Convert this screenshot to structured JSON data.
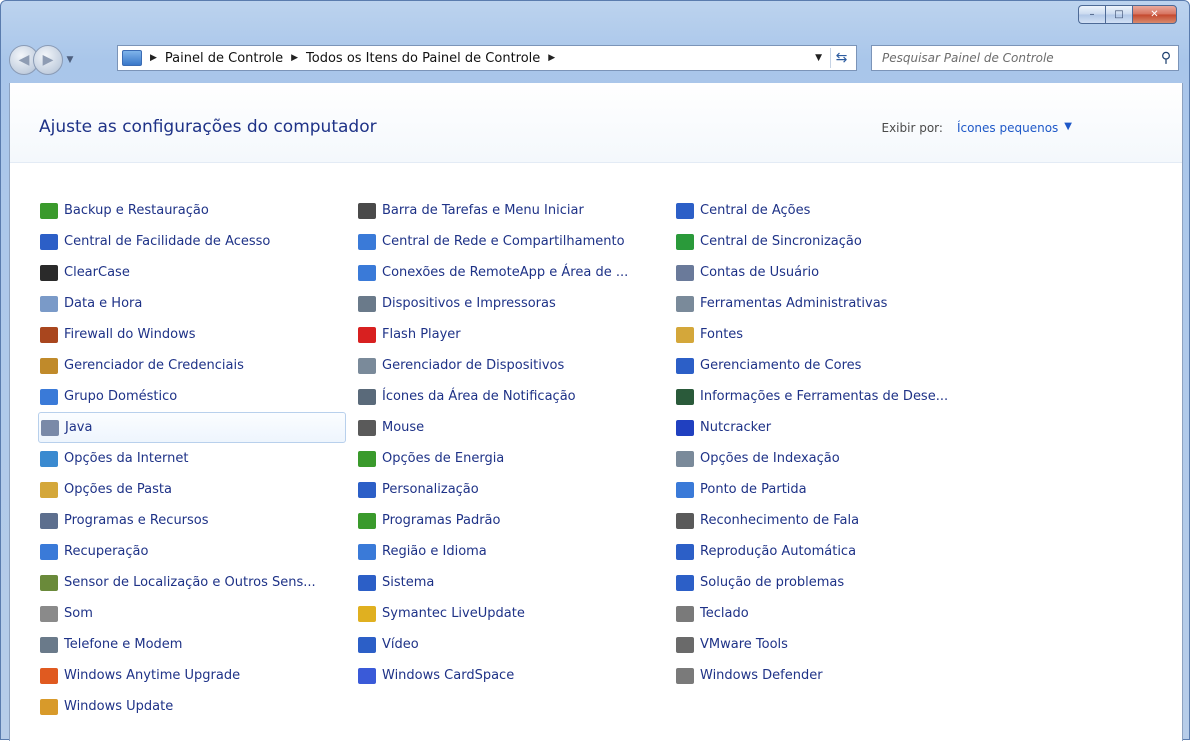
{
  "window": {
    "buttons": {
      "minimize": "–",
      "maximize": "□",
      "close": "✕"
    }
  },
  "nav": {
    "back_icon": "back-arrow-icon",
    "forward_icon": "forward-arrow-icon",
    "breadcrumbs": [
      "Painel de Controle",
      "Todos os Itens do Painel de Controle"
    ],
    "search_placeholder": "Pesquisar Painel de Controle"
  },
  "header": {
    "title": "Ajuste as configurações do computador",
    "view_by_label": "Exibir por:",
    "view_by_value": "Ícones pequenos"
  },
  "columns": [
    [
      {
        "label": "Backup e Restauração",
        "icon": "backup-icon",
        "color": "#3a9a2c"
      },
      {
        "label": "Central de Facilidade de Acesso",
        "icon": "ease-of-access-icon",
        "color": "#2c5fc7"
      },
      {
        "label": "ClearCase",
        "icon": "clearcase-icon",
        "color": "#2a2a2a"
      },
      {
        "label": "Data e Hora",
        "icon": "clock-icon",
        "color": "#7a9ac8"
      },
      {
        "label": "Firewall do Windows",
        "icon": "firewall-icon",
        "color": "#a9461e"
      },
      {
        "label": "Gerenciador de Credenciais",
        "icon": "credentials-icon",
        "color": "#c08a2a"
      },
      {
        "label": "Grupo Doméstico",
        "icon": "homegroup-icon",
        "color": "#3a7ad8"
      },
      {
        "label": "Java",
        "icon": "java-icon",
        "color": "#7a8aa8"
      },
      {
        "label": "Opções da Internet",
        "icon": "internet-options-icon",
        "color": "#3a8ad0"
      },
      {
        "label": "Opções de Pasta",
        "icon": "folder-options-icon",
        "color": "#d4a73a"
      },
      {
        "label": "Programas e Recursos",
        "icon": "programs-icon",
        "color": "#5d6f8e"
      },
      {
        "label": "Recuperação",
        "icon": "recovery-icon",
        "color": "#3a7ad8"
      },
      {
        "label": "Sensor de Localização e Outros Sens...",
        "icon": "sensor-icon",
        "color": "#6a8a3a"
      },
      {
        "label": "Som",
        "icon": "speaker-icon",
        "color": "#8a8a8a"
      },
      {
        "label": "Telefone e Modem",
        "icon": "phone-modem-icon",
        "color": "#6a7a8a"
      },
      {
        "label": "Windows Anytime Upgrade",
        "icon": "windows-flag-icon",
        "color": "#e05a20"
      },
      {
        "label": "Windows Update",
        "icon": "windows-update-icon",
        "color": "#d89a2a"
      }
    ],
    [
      {
        "label": "Barra de Tarefas e Menu Iniciar",
        "icon": "taskbar-icon",
        "color": "#4a4a4a"
      },
      {
        "label": "Central de Rede e Compartilhamento",
        "icon": "network-icon",
        "color": "#3a7ad8"
      },
      {
        "label": "Conexões de RemoteApp e Área de ...",
        "icon": "remoteapp-icon",
        "color": "#3a7ad8"
      },
      {
        "label": "Dispositivos e Impressoras",
        "icon": "printer-icon",
        "color": "#6a7a8a"
      },
      {
        "label": "Flash Player",
        "icon": "flash-icon",
        "color": "#d82020"
      },
      {
        "label": "Gerenciador de Dispositivos",
        "icon": "device-manager-icon",
        "color": "#7a8a9a"
      },
      {
        "label": "Ícones da Área de Notificação",
        "icon": "notification-icon",
        "color": "#5a6a7a"
      },
      {
        "label": "Mouse",
        "icon": "mouse-icon",
        "color": "#5a5a5a"
      },
      {
        "label": "Opções de Energia",
        "icon": "power-icon",
        "color": "#3a9a2c"
      },
      {
        "label": "Personalização",
        "icon": "personalization-icon",
        "color": "#2c5fc7"
      },
      {
        "label": "Programas Padrão",
        "icon": "default-programs-icon",
        "color": "#3a9a2c"
      },
      {
        "label": "Região e Idioma",
        "icon": "region-icon",
        "color": "#3a7ad8"
      },
      {
        "label": "Sistema",
        "icon": "system-icon",
        "color": "#2c5fc7"
      },
      {
        "label": "Symantec LiveUpdate",
        "icon": "symantec-icon",
        "color": "#e0b020"
      },
      {
        "label": "Vídeo",
        "icon": "display-icon",
        "color": "#2c5fc7"
      },
      {
        "label": "Windows CardSpace",
        "icon": "cardspace-icon",
        "color": "#3a5ad8"
      }
    ],
    [
      {
        "label": "Central de Ações",
        "icon": "action-center-flag-icon",
        "color": "#2c5fc7"
      },
      {
        "label": "Central de Sincronização",
        "icon": "sync-icon",
        "color": "#2a9a3a"
      },
      {
        "label": "Contas de Usuário",
        "icon": "user-accounts-icon",
        "color": "#6a7a9a"
      },
      {
        "label": "Ferramentas Administrativas",
        "icon": "admin-tools-icon",
        "color": "#7a8a9a"
      },
      {
        "label": "Fontes",
        "icon": "fonts-icon",
        "color": "#d4a73a"
      },
      {
        "label": "Gerenciamento de Cores",
        "icon": "color-management-icon",
        "color": "#2c5fc7"
      },
      {
        "label": "Informações e Ferramentas de Dese...",
        "icon": "performance-icon",
        "color": "#2a5a3a"
      },
      {
        "label": "Nutcracker",
        "icon": "nutcracker-icon",
        "color": "#2040c0"
      },
      {
        "label": "Opções de Indexação",
        "icon": "indexing-icon",
        "color": "#7a8a9a"
      },
      {
        "label": "Ponto de Partida",
        "icon": "getting-started-icon",
        "color": "#3a7ad8"
      },
      {
        "label": "Reconhecimento de Fala",
        "icon": "microphone-icon",
        "color": "#5a5a5a"
      },
      {
        "label": "Reprodução Automática",
        "icon": "autoplay-icon",
        "color": "#2c5fc7"
      },
      {
        "label": "Solução de problemas",
        "icon": "troubleshooting-icon",
        "color": "#2c5fc7"
      },
      {
        "label": "Teclado",
        "icon": "keyboard-icon",
        "color": "#7a7a7a"
      },
      {
        "label": "VMware Tools",
        "icon": "vmware-icon",
        "color": "#6a6a6a"
      },
      {
        "label": "Windows Defender",
        "icon": "defender-icon",
        "color": "#7a7a7a"
      }
    ]
  ]
}
